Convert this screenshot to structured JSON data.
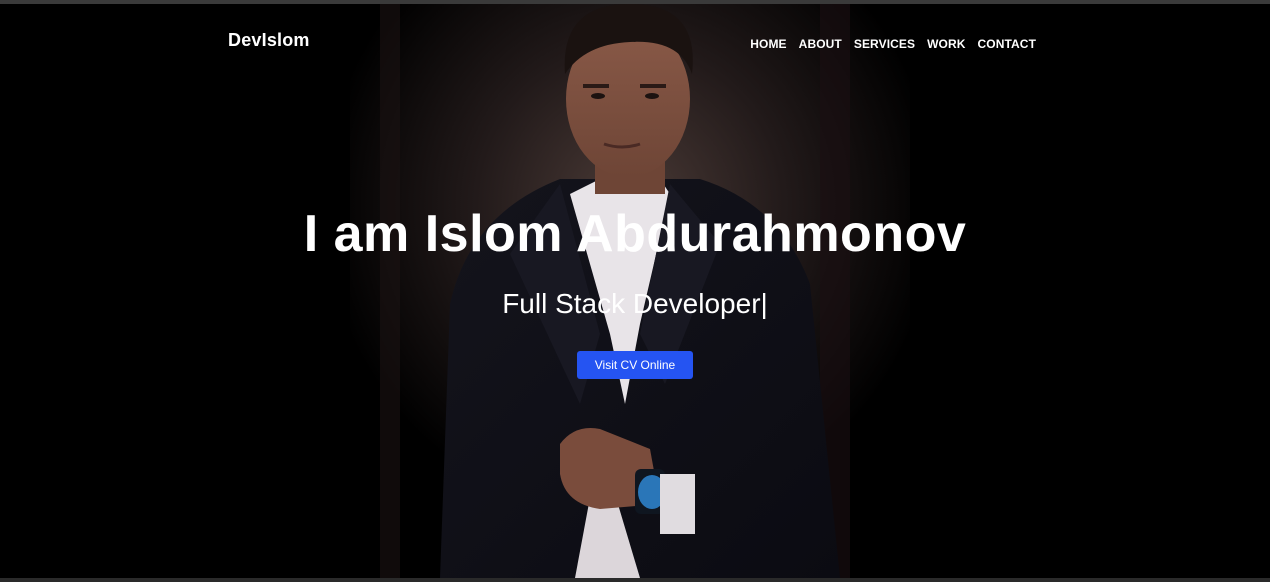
{
  "header": {
    "brand": "DevIslom",
    "nav": [
      "HOME",
      "ABOUT",
      "SERVICES",
      "WORK",
      "CONTACT"
    ]
  },
  "hero": {
    "title": "I am Islom Abdurahmonov",
    "subtitle": "Full Stack Developer",
    "cursor": "|",
    "cta_label": "Visit CV Online"
  },
  "colors": {
    "background": "#000000",
    "accent": "#2554f2",
    "text": "#ffffff"
  }
}
